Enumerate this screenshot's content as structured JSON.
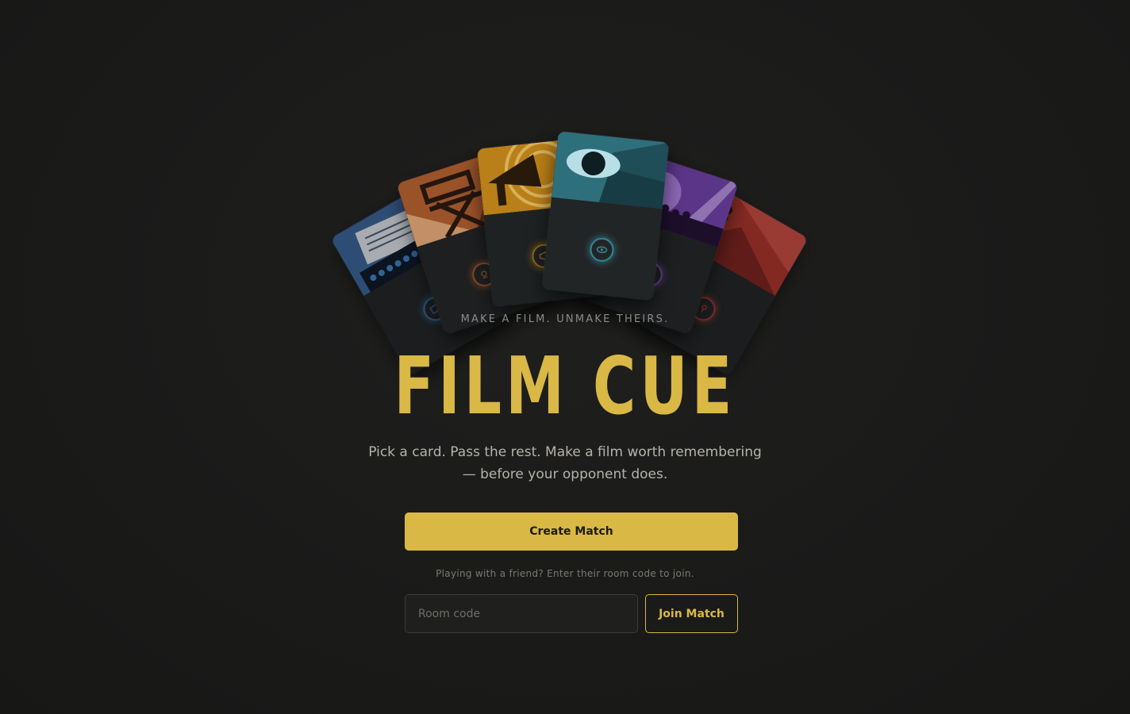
{
  "tagline": "MAKE A FILM. UNMAKE THEIRS.",
  "title": "FILM CUE",
  "subtitle": "Pick a card. Pass the rest. Make a film worth remembering — before your opponent does.",
  "create_button": "Create Match",
  "join_hint": "Playing with a friend? Enter their room code to join.",
  "room_input": {
    "placeholder": "Room code",
    "value": ""
  },
  "join_button": "Join Match",
  "colors": {
    "accent_gold": "#d9b846",
    "background": "#1b1b1a"
  },
  "cards": [
    {
      "icon": "typewriter-icon",
      "theme": "blue",
      "accent": "#3f7fc0"
    },
    {
      "icon": "director-chair-icon",
      "theme": "orange",
      "accent": "#c0632f"
    },
    {
      "icon": "megaphone-icon",
      "theme": "gold",
      "accent": "#c58a1c"
    },
    {
      "icon": "eye-icon",
      "theme": "teal",
      "accent": "#3aa7b8"
    },
    {
      "icon": "spotlight-icon",
      "theme": "purple",
      "accent": "#8e55c9"
    },
    {
      "icon": "award-statue-icon",
      "theme": "red",
      "accent": "#c0403a"
    }
  ]
}
